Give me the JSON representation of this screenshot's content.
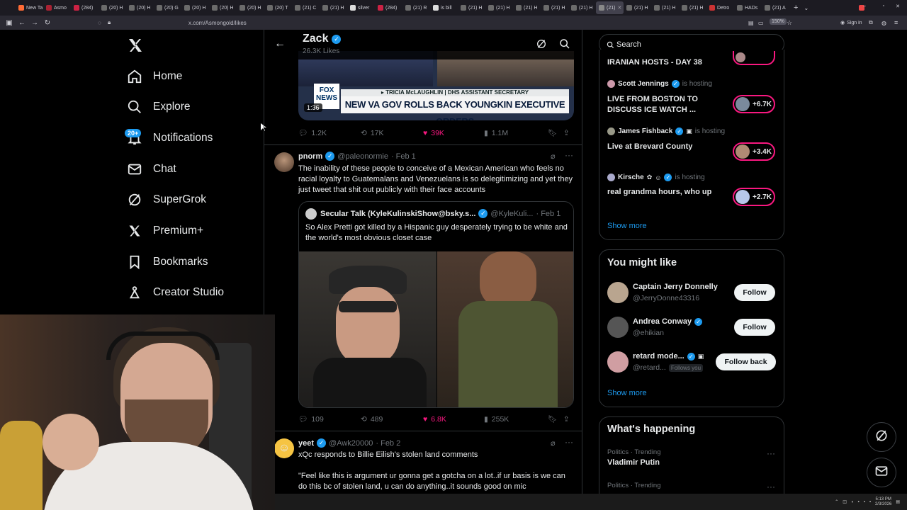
{
  "browser": {
    "tabs": [
      "New Ta",
      "Asmo",
      "(284)",
      "(20) H",
      "(20) H",
      "(20) G",
      "(20) H",
      "(20) H",
      "(20) H",
      "(20) T",
      "(21) C",
      "(21) H",
      "silver",
      "(284)",
      "(21) R",
      "is bill",
      "(21) H",
      "(21) H",
      "(21) H",
      "(21) H",
      "(21) H",
      "(21)",
      "(21) H",
      "(21) H",
      "(21) H",
      "Detro",
      "HADs",
      "(21) A"
    ],
    "active_tab_index": 21,
    "url": "x.com/Asmongold/likes",
    "zoom": "150%",
    "sign_in": "Sign in"
  },
  "sidebar": {
    "items": [
      {
        "label": "Home",
        "icon": "home-icon"
      },
      {
        "label": "Explore",
        "icon": "search-icon"
      },
      {
        "label": "Notifications",
        "icon": "bell-icon"
      },
      {
        "label": "Chat",
        "icon": "mail-icon"
      },
      {
        "label": "SuperGrok",
        "icon": "grok-icon"
      },
      {
        "label": "Premium+",
        "icon": "x-logo-icon"
      },
      {
        "label": "Bookmarks",
        "icon": "bookmark-icon"
      },
      {
        "label": "Creator Studio",
        "icon": "creator-icon"
      }
    ],
    "notifications_badge": "20+"
  },
  "profile_header": {
    "name": "Zack",
    "likes": "26.3K Likes"
  },
  "posts": [
    {
      "video_banner_source": "FOX NEWS",
      "video_banner_name": "▸ TRICIA McLAUGHLIN | DHS ASSISTANT SECRETARY",
      "video_headline": "NEW VA GOV ROLLS BACK YOUNGKIN EXECUTIVE ORDERS",
      "video_duration": "1:36",
      "replies": "1.2K",
      "reposts": "17K",
      "likes": "39K",
      "views": "1.1M"
    },
    {
      "author": "pnorm",
      "handle": "@paleonormie",
      "date": "· Feb 1",
      "text": "The inability of these people to conceive of a Mexican American who feels no racial loyalty to Guatemalans and Venezuelans is so delegitimizing and yet they just tweet that shit out publicly with their face accounts",
      "quote": {
        "author": "Secular Talk (KyleKulinskiShow@bsky.s...",
        "handle": "@KyleKuli...",
        "date": "· Feb 1",
        "text": "So Alex Pretti got killed by a Hispanic guy desperately trying to be white and the world's most obvious closet case"
      },
      "replies": "109",
      "reposts": "489",
      "likes": "6.8K",
      "views": "255K"
    },
    {
      "author": "yeet",
      "handle": "@Awk20000",
      "date": "· Feb 2",
      "text": "xQc responds to Billie Eilish's stolen land comments",
      "text2": "\"Feel like this is argument ur gonna get a gotcha on a lot..if ur basis is we can do this bc of stolen land, u can do anything..it sounds good on mic"
    }
  ],
  "right": {
    "search_placeholder": "Search",
    "live": [
      {
        "host": "",
        "title": "IRANIAN HOSTS - DAY 38",
        "count": ""
      },
      {
        "host": "Scott Jennings",
        "status": "is hosting",
        "title": "LIVE FROM BOSTON TO DISCUSS ICE WATCH ...",
        "count": "+6.7K"
      },
      {
        "host": "James Fishback",
        "status": "is hosting",
        "title": "Live at Brevard County",
        "count": "+3.4K"
      },
      {
        "host": "Kirsche",
        "status": "is hosting",
        "title": "real grandma hours, who up",
        "count": "+2.7K"
      }
    ],
    "show_more": "Show more",
    "you_might_like_title": "You might like",
    "suggestions": [
      {
        "name": "Captain Jerry Donnelly",
        "handle": "@JerryDonne43316",
        "button": "Follow"
      },
      {
        "name": "Andrea Conway",
        "handle": "@ehikian",
        "button": "Follow"
      },
      {
        "name": "retard mode...",
        "handle": "@retard...",
        "follows_you": "Follows you",
        "button": "Follow back"
      }
    ],
    "show_more_2": "Show more",
    "whats_happening_title": "What's happening",
    "trends": [
      {
        "context": "Politics · Trending",
        "name": "Vladimir Putin"
      },
      {
        "context": "Politics · Trending",
        "name": ""
      }
    ]
  },
  "taskbar": {
    "time": "5:13 PM",
    "date": "2/3/2026"
  },
  "colors": {
    "accent": "#1d9bf0",
    "like_pink": "#f91880",
    "background": "#000000",
    "border": "#2f3336"
  }
}
